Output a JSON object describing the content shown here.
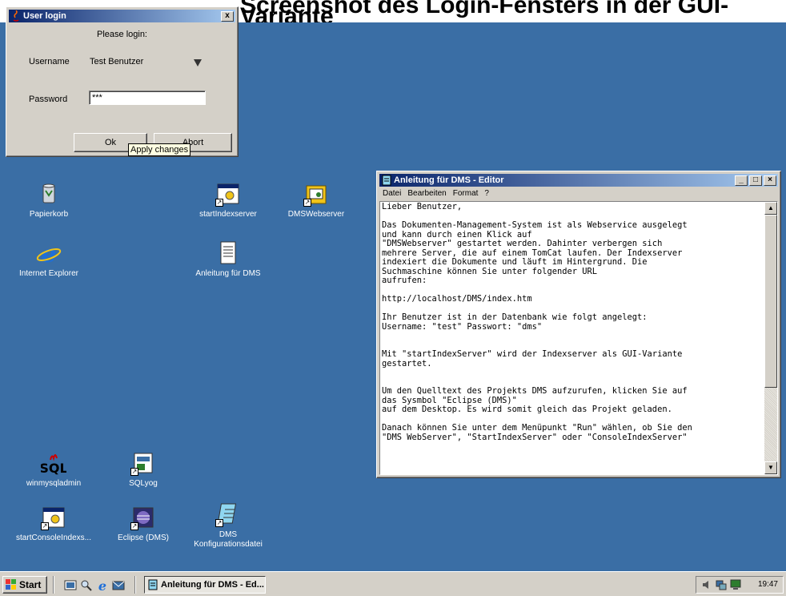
{
  "slide_title": "Screenshot des Login-Fensters in der GUI-Variante",
  "login_window": {
    "title": "User login",
    "close_label": "x",
    "prompt": "Please login:",
    "username_label": "Username",
    "username_value": "Test Benutzer",
    "password_label": "Password",
    "password_value": "***",
    "ok_label": "Ok",
    "abort_label": "Abort",
    "tooltip": "Apply changes"
  },
  "desktop_icons": [
    {
      "label": "Papierkorb",
      "icon": "recycle-bin-icon"
    },
    {
      "label": "Internet Explorer",
      "icon": "internet-explorer-icon"
    },
    {
      "label": "startIndexserver",
      "icon": "batch-file-icon"
    },
    {
      "label": "Anleitung für DMS",
      "icon": "text-document-icon"
    },
    {
      "label": "DMSWebserver",
      "icon": "batch-file-icon"
    },
    {
      "label": "winmysqladmin",
      "icon": "sql-icon"
    },
    {
      "label": "SQLyog",
      "icon": "sqlyog-icon"
    },
    {
      "label": "startConsoleIndexs...",
      "icon": "batch-file-icon"
    },
    {
      "label": "Eclipse (DMS)",
      "icon": "eclipse-icon"
    },
    {
      "label": "DMS Konfigurationsdatei",
      "icon": "notepad-file-icon"
    }
  ],
  "notepad": {
    "title": "Anleitung für DMS - Editor",
    "menu": [
      "Datei",
      "Bearbeiten",
      "Format",
      "?"
    ],
    "text": "Lieber Benutzer,\n\nDas Dokumenten-Management-System ist als Webservice ausgelegt\nund kann durch einen Klick auf\n\"DMSWebserver\" gestartet werden. Dahinter verbergen sich\nmehrere Server, die auf einem TomCat laufen. Der Indexserver\nindexiert die Dokumente und läuft im Hintergrund. Die\nSuchmaschine können Sie unter folgender URL\naufrufen:\n\nhttp://localhost/DMS/index.htm\n\nIhr Benutzer ist in der Datenbank wie folgt angelegt:\nUsername: \"test\" Passwort: \"dms\"\n\n\nMit \"startIndexServer\" wird der Indexserver als GUI-Variante\ngestartet.\n\n\nUm den Quelltext des Projekts DMS aufzurufen, klicken Sie auf\ndas Sysmbol \"Eclipse (DMS)\"\nauf dem Desktop. Es wird somit gleich das Projekt geladen.\n\nDanach können Sie unter dem Menüpunkt \"Run\" wählen, ob Sie den\n\"DMS WebServer\", \"StartIndexServer\" oder \"ConsoleIndexServer\""
  },
  "taskbar": {
    "start_label": "Start",
    "active_task": "Anleitung für DMS - Ed...",
    "clock": "19:47"
  },
  "colors": {
    "desktop": "#3a6ea5",
    "titlebar_active": "#0a246a",
    "face": "#d4d0c8"
  }
}
